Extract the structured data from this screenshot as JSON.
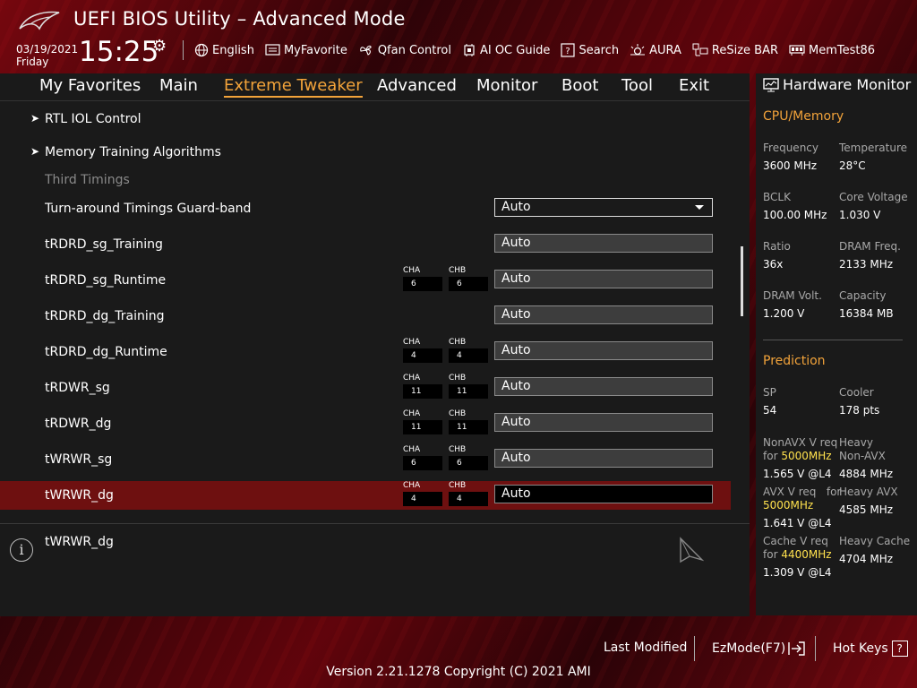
{
  "header": {
    "title": "UEFI BIOS Utility – Advanced Mode",
    "date": "03/19/2021",
    "day": "Friday",
    "time": "15:25",
    "tools": [
      {
        "label": "English",
        "icon": "globe-icon"
      },
      {
        "label": "MyFavorite",
        "icon": "favorite-icon"
      },
      {
        "label": "Qfan Control",
        "icon": "fan-icon"
      },
      {
        "label": "AI OC Guide",
        "icon": "oc-guide-icon"
      },
      {
        "label": "Search",
        "icon": "search-icon"
      },
      {
        "label": "AURA",
        "icon": "aura-icon"
      },
      {
        "label": "ReSize BAR",
        "icon": "resize-bar-icon"
      },
      {
        "label": "MemTest86",
        "icon": "memtest-icon"
      }
    ]
  },
  "nav": {
    "tabs": [
      "My Favorites",
      "Main",
      "Extreme Tweaker",
      "Advanced",
      "Monitor",
      "Boot",
      "Tool",
      "Exit"
    ],
    "active": "Extreme Tweaker"
  },
  "settings": {
    "rows": [
      {
        "label": "RTL IOL Control"
      },
      {
        "label": "Memory Training Algorithms"
      },
      {
        "label": "Third Timings"
      },
      {
        "label": "Turn-around Timings Guard-band",
        "value": "Auto"
      },
      {
        "label": "tRDRD_sg_Training",
        "value": "Auto"
      },
      {
        "label": "tRDRD_sg_Runtime",
        "cha": "6",
        "chb": "6",
        "value": "Auto"
      },
      {
        "label": "tRDRD_dg_Training",
        "value": "Auto"
      },
      {
        "label": "tRDRD_dg_Runtime",
        "cha": "4",
        "chb": "4",
        "value": "Auto"
      },
      {
        "label": "tRDWR_sg",
        "cha": "11",
        "chb": "11",
        "value": "Auto"
      },
      {
        "label": "tRDWR_dg",
        "cha": "11",
        "chb": "11",
        "value": "Auto"
      },
      {
        "label": "tWRWR_sg",
        "cha": "6",
        "chb": "6",
        "value": "Auto"
      },
      {
        "label": "tWRWR_dg",
        "cha": "4",
        "chb": "4",
        "value": "Auto"
      }
    ],
    "cha_label": "CHA",
    "chb_label": "CHB"
  },
  "help": {
    "text": "tWRWR_dg"
  },
  "hardware_monitor": {
    "title": "Hardware Monitor",
    "cpu_memory": {
      "title": "CPU/Memory",
      "frequency_label": "Frequency",
      "frequency": "3600 MHz",
      "temperature_label": "Temperature",
      "temperature": "28°C",
      "bclk_label": "BCLK",
      "bclk": "100.00 MHz",
      "core_voltage_label": "Core Voltage",
      "core_voltage": "1.030 V",
      "ratio_label": "Ratio",
      "ratio": "36x",
      "dram_freq_label": "DRAM Freq.",
      "dram_freq": "2133 MHz",
      "dram_volt_label": "DRAM Volt.",
      "dram_volt": "1.200 V",
      "capacity_label": "Capacity",
      "capacity": "16384 MB"
    },
    "prediction": {
      "title": "Prediction",
      "sp_label": "SP",
      "sp": "54",
      "cooler_label": "Cooler",
      "cooler": "178 pts",
      "nonavx_label": "NonAVX V req",
      "nonavx_for": "for",
      "nonavx_freq": "5000MHz",
      "nonavx_value": "1.565 V @L4",
      "heavy_nonavx_label1": "Heavy",
      "heavy_nonavx_label2": "Non-AVX",
      "heavy_nonavx_value": "4884 MHz",
      "avx_label": "AVX V req",
      "avx_for": "for",
      "avx_freq": "5000MHz",
      "avx_value": "1.641 V @L4",
      "heavy_avx_label": "Heavy AVX",
      "heavy_avx_value": "4585 MHz",
      "cache_label": "Cache V req",
      "cache_for": "for",
      "cache_freq": "4400MHz",
      "cache_value": "1.309 V @L4",
      "heavy_cache_label": "Heavy Cache",
      "heavy_cache_value": "4704 MHz"
    }
  },
  "footer": {
    "last_modified": "Last Modified",
    "ezmode": "EzMode(F7)",
    "hot_keys": "Hot Keys",
    "hot_keys_key": "?",
    "version": "Version 2.21.1278 Copyright (C) 2021 AMI"
  },
  "colors": {
    "accent": "#f2a33a",
    "highlight": "#ffe14d",
    "selected_row": "#6e1010",
    "panel": "#1a1a1a"
  }
}
